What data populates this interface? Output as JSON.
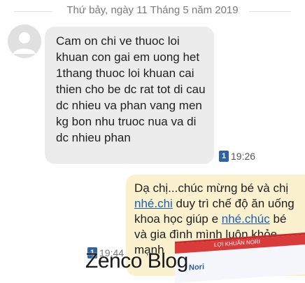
{
  "date_divider": {
    "text": "Thứ bảy, ngày 11 Tháng 5 năm 2019"
  },
  "incoming_message": {
    "text": "Cam on chi ve thuoc loi khuan con gai em uong het 1thang thuoc loi khuan cai thien cho be dc rat tot di cau dc nhieu va phan vang men kg bon nhu truoc nua va di dc nhieu phan",
    "badge": "1",
    "time": "19:26"
  },
  "outgoing_message": {
    "part1": "Dạ chị...chúc mừng bé và chị ",
    "link1": "nhé.chi",
    "part2": " duy trì chế độ ăn uống   khoa học giúp e ",
    "link2": "nhé.chúc",
    "part3": " bé và gia đình mình luôn khỏe mạnh",
    "badge": "1",
    "time": "19:44"
  },
  "product_box": {
    "label": "LỢI KHUẨN NORI",
    "brand": "Nori"
  },
  "watermark": {
    "text": "Zenco Blog"
  },
  "colors": {
    "incoming_bubble": "#ececec",
    "outgoing_bubble": "#fbf1cf",
    "link": "#1a5fb4",
    "badge": "#2d62a8"
  }
}
